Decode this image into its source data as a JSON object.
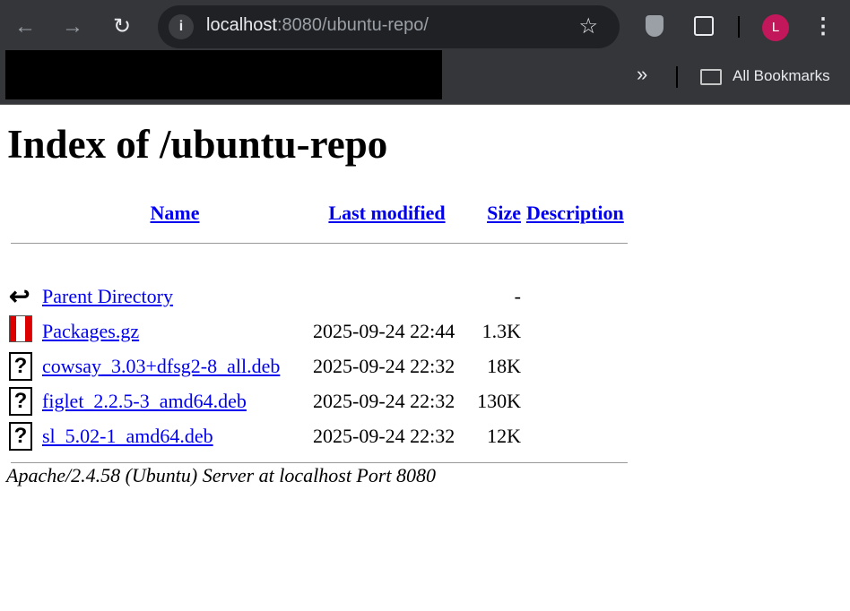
{
  "browser": {
    "url_host": "localhost",
    "url_rest": ":8080/ubuntu-repo/",
    "bookmarks_label": "All Bookmarks",
    "profile_initial": "L",
    "overflow": "»"
  },
  "page": {
    "title": "Index of /ubuntu-repo",
    "columns": {
      "name": "Name",
      "modified": "Last modified",
      "size": "Size",
      "description": "Description"
    },
    "rows": [
      {
        "name": "Parent Directory",
        "modified": "",
        "size": "-",
        "icon": "back-icon"
      },
      {
        "name": "Packages.gz",
        "modified": "2025-09-24 22:44",
        "size": "1.3K",
        "icon": "compressed-icon"
      },
      {
        "name": "cowsay_3.03+dfsg2-8_all.deb",
        "modified": "2025-09-24 22:32",
        "size": "18K",
        "icon": "unknown-file-icon"
      },
      {
        "name": "figlet_2.2.5-3_amd64.deb",
        "modified": "2025-09-24 22:32",
        "size": "130K",
        "icon": "unknown-file-icon"
      },
      {
        "name": "sl_5.02-1_amd64.deb",
        "modified": "2025-09-24 22:32",
        "size": "12K",
        "icon": "unknown-file-icon"
      }
    ],
    "footer": "Apache/2.4.58 (Ubuntu) Server at localhost Port 8080"
  }
}
